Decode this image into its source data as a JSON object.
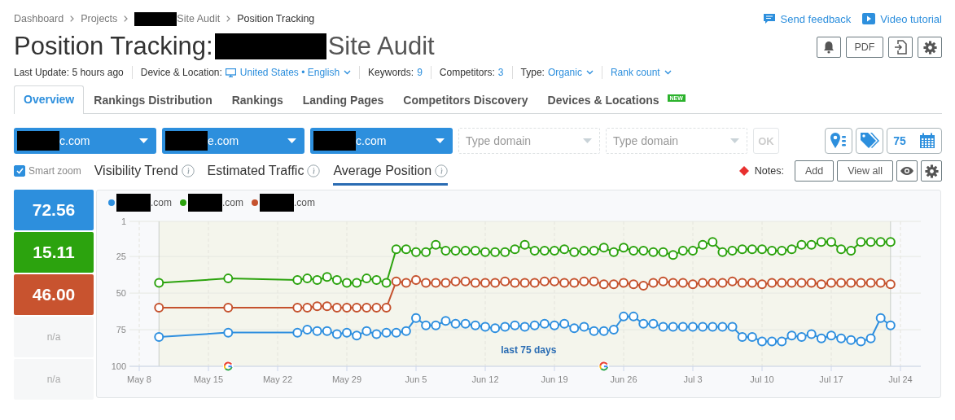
{
  "header_links": [
    {
      "kind": "feedback",
      "label": "Send feedback"
    },
    {
      "kind": "video",
      "label": "Video tutorial"
    }
  ],
  "breadcrumb": [
    {
      "label": "Dashboard",
      "redacted_before": false,
      "current": false
    },
    {
      "label": "Projects",
      "redacted_before": false,
      "current": false
    },
    {
      "label": "Site Audit",
      "redacted_before": true,
      "current": false
    },
    {
      "label": "Position Tracking",
      "redacted_before": false,
      "current": true
    }
  ],
  "title": {
    "lead": "Position Tracking:",
    "tail": "Site Audit"
  },
  "toolbar": [
    {
      "kind": "bell"
    },
    {
      "kind": "text",
      "label": "PDF"
    },
    {
      "kind": "export"
    },
    {
      "kind": "gear"
    }
  ],
  "meta": [
    {
      "label": "Last Update: 5 hours ago"
    },
    {
      "label": "Device & Location:",
      "kind": "device",
      "value": "United States • English",
      "dropdown": true
    },
    {
      "label": "Keywords:",
      "value": "9",
      "dropdown": false
    },
    {
      "label": "Competitors:",
      "value": "3",
      "dropdown": false
    },
    {
      "label": "Type:",
      "value": "Organic",
      "dropdown": true
    },
    {
      "value": "Rank count",
      "dropdown": true
    }
  ],
  "tabs": [
    {
      "label": "Overview",
      "selected": true
    },
    {
      "label": "Rankings Distribution",
      "selected": false
    },
    {
      "label": "Rankings",
      "selected": false
    },
    {
      "label": "Landing Pages",
      "selected": false
    },
    {
      "label": "Competitors Discovery",
      "selected": false
    },
    {
      "label": "Devices & Locations",
      "selected": false,
      "badge": "NEW"
    }
  ],
  "domains": [
    {
      "kind": "domain",
      "text": "c.com",
      "redacted": true
    },
    {
      "kind": "domain",
      "text": "e.com",
      "redacted": true
    },
    {
      "kind": "domain",
      "text": "c.com",
      "redacted": true
    },
    {
      "kind": "input",
      "placeholder": "Type domain"
    },
    {
      "kind": "input",
      "placeholder": "Type domain"
    }
  ],
  "ok_button": {
    "label": "OK",
    "disabled": true
  },
  "period": {
    "label": "75"
  },
  "smart_zoom": {
    "label": "Smart zoom",
    "checked": true
  },
  "chart_tabs": [
    {
      "label": "Visibility Trend",
      "selected": false
    },
    {
      "label": "Estimated Traffic",
      "selected": false
    },
    {
      "label": "Average Position",
      "selected": true
    }
  ],
  "notes": {
    "label": "Notes:",
    "buttons": [
      "Add",
      "View all"
    ]
  },
  "metrics": [
    {
      "value": "72.56",
      "color": "#2d8fdd"
    },
    {
      "value": "15.11",
      "color": "#2ca30e"
    },
    {
      "value": "46.00",
      "color": "#c8532f"
    },
    {
      "value": "n/a"
    },
    {
      "value": "n/a"
    }
  ],
  "chart": {
    "range_label": "last 75 days",
    "chart_data": {
      "type": "line",
      "grid": true,
      "categories": [
        "May 8",
        null,
        null,
        null,
        null,
        null,
        null,
        "May 15",
        null,
        null,
        null,
        null,
        null,
        null,
        "May 22",
        null,
        null,
        null,
        null,
        null,
        null,
        "May 29",
        null,
        null,
        null,
        null,
        null,
        null,
        "Jun 5",
        null,
        null,
        null,
        null,
        null,
        null,
        "Jun 12",
        null,
        null,
        null,
        null,
        null,
        null,
        "Jun 19",
        null,
        null,
        null,
        null,
        null,
        null,
        "Jun 26",
        null,
        null,
        null,
        null,
        null,
        null,
        "Jul 3",
        null,
        null,
        null,
        null,
        null,
        null,
        "Jul 10",
        null,
        null,
        null,
        null,
        null,
        null,
        "Jul 17",
        null,
        null,
        null,
        null,
        null,
        null,
        "Jul 24"
      ],
      "series": [
        {
          "name": ".com",
          "color": "#2e8fdf",
          "marker": "circle",
          "values": [
            null,
            null,
            80,
            null,
            null,
            null,
            null,
            null,
            null,
            77,
            null,
            null,
            null,
            null,
            null,
            null,
            77,
            75,
            76,
            76,
            78,
            77,
            79,
            76,
            78,
            77,
            77,
            76,
            67,
            72,
            72,
            69,
            71,
            71,
            72,
            73,
            74,
            73,
            72,
            73,
            72,
            71,
            72,
            71,
            74,
            73,
            76,
            76,
            75,
            66,
            66,
            71,
            71,
            73,
            73,
            73,
            73,
            73,
            73,
            73,
            73,
            80,
            80,
            83,
            83,
            83,
            79,
            80,
            78,
            81,
            79,
            81,
            82,
            83,
            81,
            67,
            72,
            null
          ]
        },
        {
          "name": ".com",
          "color": "#2ca30e",
          "marker": "circle",
          "values": [
            null,
            null,
            43,
            null,
            null,
            null,
            null,
            null,
            null,
            40,
            null,
            null,
            null,
            null,
            null,
            null,
            41,
            40,
            41,
            39,
            41,
            43,
            43,
            40,
            41,
            43,
            20,
            20,
            22,
            22,
            17,
            21,
            21,
            21,
            21,
            22,
            22,
            22,
            20,
            17,
            21,
            21,
            21,
            20,
            22,
            21,
            21,
            19,
            22,
            19,
            21,
            21,
            22,
            22,
            24,
            21,
            21,
            17,
            15,
            22,
            21,
            20,
            20,
            20,
            21,
            21,
            20,
            17,
            17,
            15,
            15,
            20,
            21,
            15,
            15,
            15,
            15,
            null
          ]
        },
        {
          "name": ".com",
          "color": "#c5522e",
          "marker": "circle",
          "values": [
            null,
            null,
            60,
            null,
            null,
            null,
            null,
            null,
            null,
            60,
            null,
            null,
            null,
            null,
            null,
            null,
            60,
            60,
            59,
            59,
            60,
            60,
            60,
            60,
            60,
            60,
            42,
            43,
            41,
            43,
            43,
            43,
            42,
            42,
            43,
            43,
            43,
            42,
            43,
            43,
            43,
            42,
            42,
            43,
            43,
            42,
            42,
            44,
            44,
            43,
            44,
            45,
            43,
            42,
            43,
            43,
            44,
            43,
            43,
            43,
            42,
            43,
            43,
            44,
            43,
            43,
            43,
            43,
            43,
            44,
            43,
            43,
            43,
            43,
            43,
            43,
            44,
            null
          ]
        }
      ],
      "ylim": [
        100,
        1
      ],
      "yticks": [
        1,
        25,
        50,
        75,
        100
      ]
    }
  }
}
